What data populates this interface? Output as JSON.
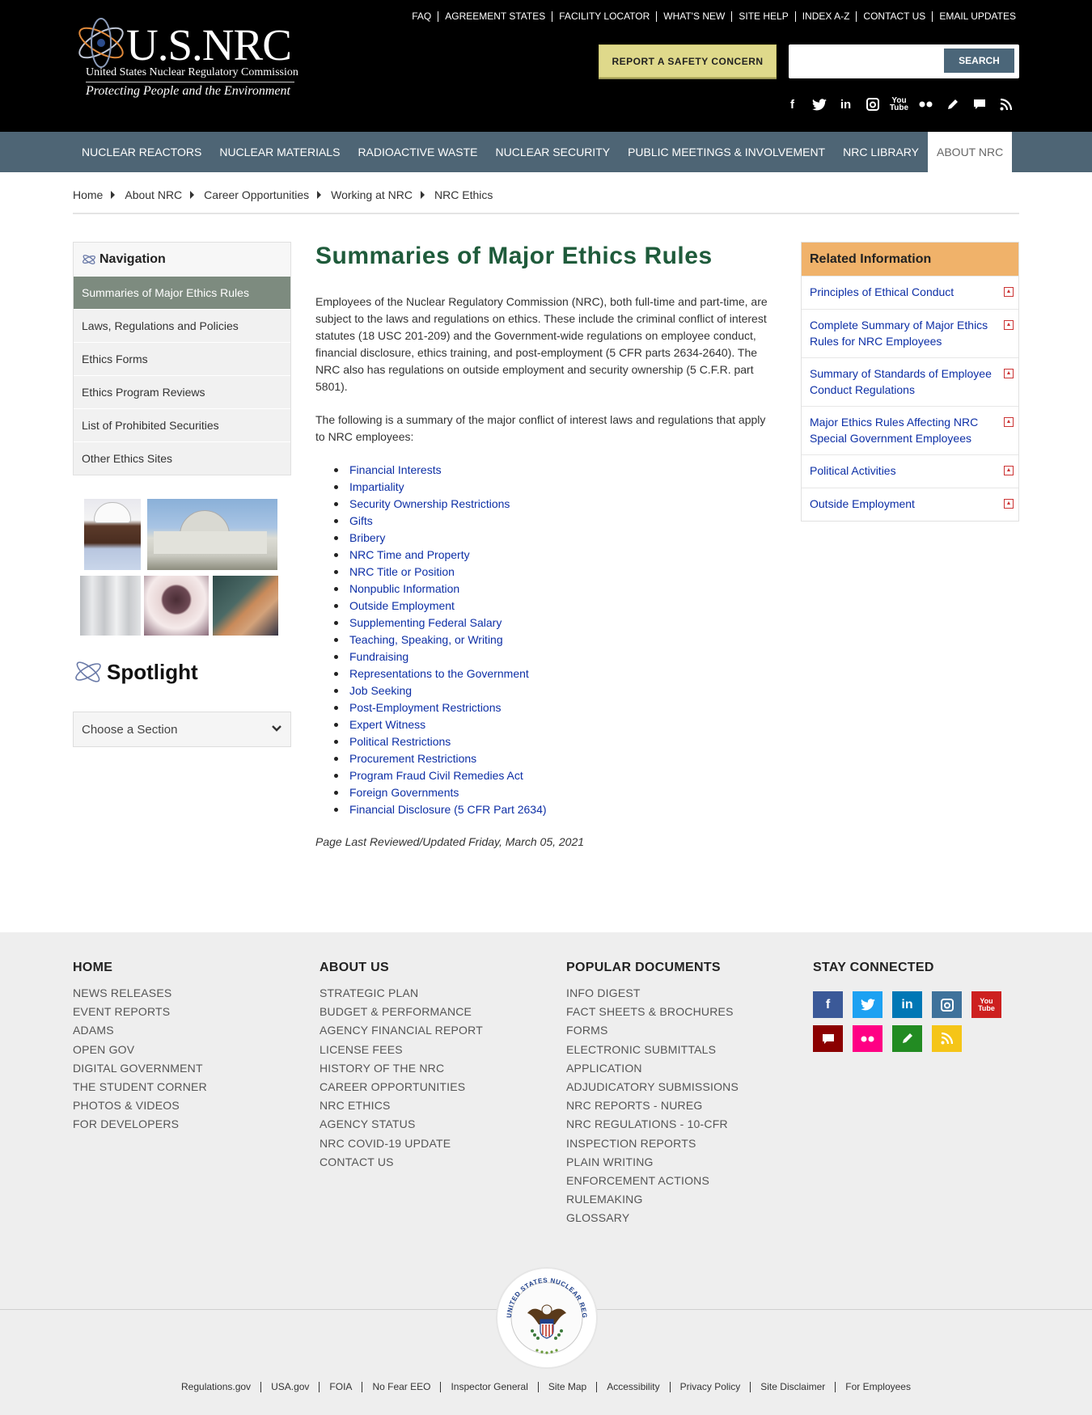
{
  "header": {
    "logo": {
      "title": "U.S.NRC",
      "subtitle": "United States Nuclear Regulatory Commission",
      "tagline": "Protecting People and the Environment"
    },
    "utility_links": [
      "FAQ",
      "AGREEMENT STATES",
      "FACILITY LOCATOR",
      "WHAT'S NEW",
      "SITE HELP",
      "INDEX A-Z",
      "CONTACT US",
      "EMAIL UPDATES"
    ],
    "report_button": "REPORT A SAFETY CONCERN",
    "search": {
      "value": "",
      "placeholder": "",
      "button": "SEARCH"
    },
    "social_icons": [
      "facebook-icon",
      "twitter-icon",
      "linkedin-icon",
      "instagram-icon",
      "youtube-icon",
      "flickr-icon",
      "blog-icon",
      "comment-icon",
      "rss-icon"
    ]
  },
  "main_nav": {
    "items": [
      "NUCLEAR REACTORS",
      "NUCLEAR MATERIALS",
      "RADIOACTIVE WASTE",
      "NUCLEAR SECURITY",
      "PUBLIC MEETINGS & INVOLVEMENT",
      "NRC LIBRARY",
      "ABOUT NRC"
    ],
    "active": "ABOUT NRC"
  },
  "breadcrumb": [
    "Home",
    "About NRC",
    "Career Opportunities",
    "Working at NRC",
    "NRC Ethics"
  ],
  "left_nav": {
    "heading": "Navigation",
    "items": [
      "Summaries of Major Ethics Rules",
      "Laws, Regulations and Policies",
      "Ethics Forms",
      "Ethics Program Reviews",
      "List of Prohibited Securities",
      "Other Ethics Sites"
    ],
    "active": "Summaries of Major Ethics Rules"
  },
  "spotlight": {
    "title": "Spotlight",
    "select_value": "Choose a Section"
  },
  "main": {
    "title": "Summaries of Major Ethics Rules",
    "intro": "Employees of the Nuclear Regulatory Commission (NRC), both full-time and part-time, are subject to the laws and regulations on ethics. These include the criminal conflict of interest statutes (18 USC 201-209) and the Government-wide regulations on employee conduct, financial disclosure, ethics training, and post-employment (5 CFR parts 2634-2640). The NRC also has regulations on outside employment and security ownership (5 C.F.R. part 5801).",
    "followup": "The following is a summary of the major conflict of interest laws and regulations that apply to NRC employees:",
    "topics": [
      "Financial Interests",
      "Impartiality",
      "Security Ownership Restrictions",
      "Gifts",
      "Bribery",
      "NRC Time and Property",
      "NRC Title or Position",
      "Nonpublic Information",
      "Outside Employment",
      "Supplementing Federal Salary",
      "Teaching, Speaking, or Writing",
      "Fundraising",
      "Representations to the Government",
      "Job Seeking",
      "Post-Employment Restrictions",
      "Expert Witness",
      "Political Restrictions",
      "Procurement Restrictions",
      "Program Fraud Civil Remedies Act",
      "Foreign Governments",
      "Financial Disclosure (5 CFR Part 2634)"
    ],
    "last_reviewed": "Page Last Reviewed/Updated Friday, March 05, 2021"
  },
  "related": {
    "heading": "Related Information",
    "items": [
      "Principles of Ethical Conduct",
      "Complete Summary of Major Ethics Rules for NRC Employees",
      "Summary of Standards of Employee Conduct Regulations",
      "Major Ethics Rules Affecting NRC Special Government Employees",
      "Political Activities",
      "Outside Employment"
    ]
  },
  "footer": {
    "columns": [
      {
        "heading": "HOME",
        "links": [
          "NEWS RELEASES",
          "EVENT REPORTS",
          "ADAMS",
          "OPEN GOV",
          "DIGITAL GOVERNMENT",
          "THE STUDENT CORNER",
          "PHOTOS & VIDEOS",
          "FOR DEVELOPERS"
        ]
      },
      {
        "heading": "ABOUT US",
        "links": [
          "STRATEGIC PLAN",
          "BUDGET & PERFORMANCE",
          "AGENCY FINANCIAL REPORT",
          "LICENSE FEES",
          "HISTORY OF THE NRC",
          "CAREER OPPORTUNITIES",
          "NRC ETHICS",
          "AGENCY STATUS",
          "NRC COVID-19 UPDATE",
          "CONTACT US"
        ]
      },
      {
        "heading": "POPULAR DOCUMENTS",
        "links": [
          "INFO DIGEST",
          "FACT SHEETS & BROCHURES",
          "FORMS",
          "ELECTRONIC SUBMITTALS",
          "APPLICATION",
          "ADJUDICATORY SUBMISSIONS",
          "NRC REPORTS - NUREG",
          "NRC REGULATIONS - 10-CFR",
          "INSPECTION REPORTS",
          "PLAIN WRITING",
          "ENFORCEMENT ACTIONS",
          "RULEMAKING",
          "GLOSSARY"
        ]
      },
      {
        "heading": "STAY CONNECTED",
        "links": []
      }
    ],
    "social": [
      {
        "icon": "facebook-icon",
        "color": "#3b5998"
      },
      {
        "icon": "twitter-icon",
        "color": "#1da1f2"
      },
      {
        "icon": "linkedin-icon",
        "color": "#0077b5"
      },
      {
        "icon": "instagram-icon",
        "color": "#3f729b"
      },
      {
        "icon": "youtube-icon",
        "color": "#cd201f"
      },
      {
        "icon": "comment-icon",
        "color": "#8b0000"
      },
      {
        "icon": "flickr-icon",
        "color": "#ff0084"
      },
      {
        "icon": "blog-icon",
        "color": "#228b22"
      },
      {
        "icon": "rss-icon",
        "color": "#f5c518"
      }
    ],
    "seal_text": "UNITED STATES NUCLEAR REGULATORY COMMISSION",
    "bottom_links": [
      "Regulations.gov",
      "USA.gov",
      "FOIA",
      "No Fear EEO",
      "Inspector General",
      "Site Map",
      "Accessibility",
      "Privacy Policy",
      "Site Disclaimer",
      "For Employees"
    ]
  },
  "colors": {
    "header_bg": "#000000",
    "nav_bg": "#4e6575",
    "report_btn": "#dfd98b",
    "title_green": "#1f5b3b",
    "link_blue": "#0d2fa6",
    "related_head": "#f0b26a",
    "left_active": "#7d8b7f",
    "footer_bg": "#eeeeee"
  }
}
